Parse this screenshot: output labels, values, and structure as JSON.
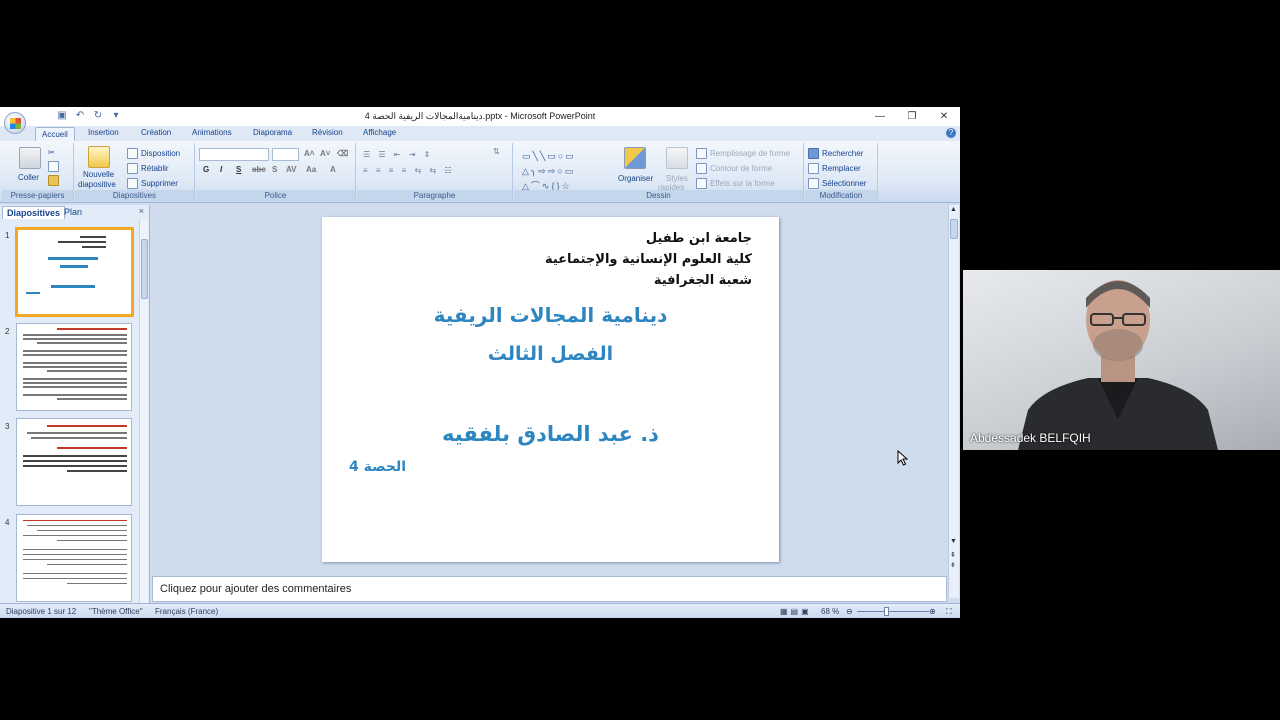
{
  "window": {
    "title": "ديناميةالمجالات الريفية الحصة 4.pptx - Microsoft PowerPoint",
    "minimize": "—",
    "restore": "❐",
    "close": "✕"
  },
  "tabs": [
    "Accueil",
    "Insertion",
    "Création",
    "Animations",
    "Diaporama",
    "Révision",
    "Affichage"
  ],
  "ribbon": {
    "clipboard": {
      "paste": "Coller",
      "label": "Presse-papiers"
    },
    "slides": {
      "new_slide_1": "Nouvelle",
      "new_slide_2": "diapositive",
      "layout": "Disposition",
      "reset": "Rétablir",
      "delete": "Supprimer",
      "label": "Diapositives"
    },
    "font": {
      "label": "Police"
    },
    "paragraph": {
      "label": "Paragraphe"
    },
    "drawing": {
      "arrange": "Organiser",
      "quick_styles_1": "Styles",
      "quick_styles_2": "rapides",
      "shape_fill": "Remplissage de forme",
      "shape_outline": "Contour de forme",
      "shape_effects": "Effets sur la forme",
      "label": "Dessin"
    },
    "editing": {
      "find": "Rechercher",
      "replace": "Remplacer",
      "select": "Sélectionner",
      "label": "Modification"
    }
  },
  "panel": {
    "tab_slides": "Diapositives",
    "tab_outline": "Plan",
    "close": "×"
  },
  "thumbnails": [
    "1",
    "2",
    "3",
    "4"
  ],
  "slide": {
    "line1": "جامعة ابن طفيل",
    "line2": "كلية العلوم الإنسانية والإجتماعية",
    "line3": "شعبة الجغرافية",
    "title": "دينامية المجالات الريفية",
    "subtitle": "الفصل الثالث",
    "author": "ذ. عبد الصادق بلفقيه",
    "session": "الحصة 4"
  },
  "notes_placeholder": "Cliquez pour ajouter des commentaires",
  "status": {
    "slide_count": "Diapositive 1 sur 12",
    "theme": "\"Thème Office\"",
    "language": "Français (France)",
    "zoom": "68 %"
  },
  "zoom_level": 0.4,
  "webcam": {
    "name": "Abdessadek BELFQIH"
  },
  "colors": {
    "slide_title": "#2e86c1",
    "session": "#2e86c1",
    "accent": "#f5a623"
  }
}
